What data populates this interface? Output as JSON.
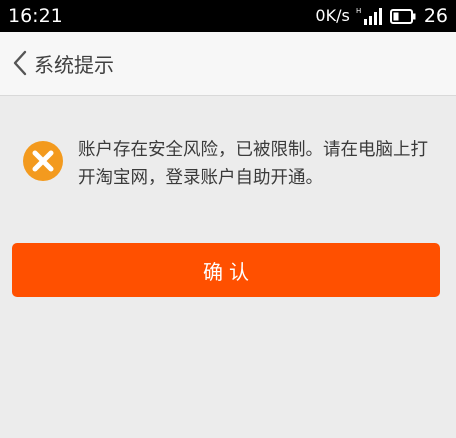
{
  "status_bar": {
    "time": "16:21",
    "net_speed": "0K/s",
    "battery": "26"
  },
  "nav": {
    "back_icon": "chevron-left-icon",
    "title": "系统提示"
  },
  "message": {
    "icon": "close-circle-icon",
    "text": "账户存在安全风险，已被限制。请在电脑上打开淘宝网，登录账户自助开通。"
  },
  "confirm_button": {
    "label": "确认"
  },
  "colors": {
    "status_bar_bg": "#000000",
    "nav_bg": "#f7f7f7",
    "page_bg": "#ececec",
    "accent_orange": "#ff5000",
    "error_icon_orange": "#f39a1e"
  }
}
